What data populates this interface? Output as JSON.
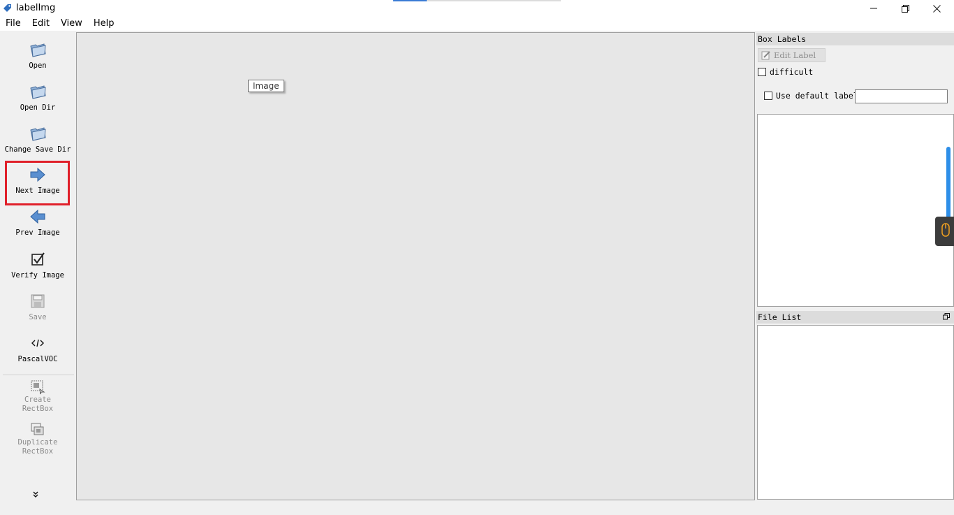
{
  "window": {
    "title": "labelImg",
    "minimize_icon": "minimize-icon",
    "maximize_icon": "restore-icon",
    "close_icon": "close-icon"
  },
  "menu": [
    "File",
    "Edit",
    "View",
    "Help"
  ],
  "toolbar": {
    "items": [
      {
        "label": "Open",
        "icon": "folder-icon",
        "enabled": true
      },
      {
        "label": "Open Dir",
        "icon": "folder-icon",
        "enabled": true
      },
      {
        "label": "Change Save Dir",
        "icon": "folder-icon",
        "enabled": true
      },
      {
        "label": "Next Image",
        "icon": "arrow-right-icon",
        "enabled": true,
        "highlighted": true
      },
      {
        "label": "Prev Image",
        "icon": "arrow-left-icon",
        "enabled": true
      },
      {
        "label": "Verify Image",
        "icon": "checkbox-icon",
        "enabled": true
      },
      {
        "label": "Save",
        "icon": "floppy-icon",
        "enabled": false
      },
      {
        "label": "PascalVOC",
        "icon": "code-icon",
        "enabled": true
      },
      {
        "label": "Create\nRectBox",
        "icon": "rectbox-icon",
        "enabled": false
      },
      {
        "label": "Duplicate\nRectBox",
        "icon": "duplicate-icon",
        "enabled": false
      }
    ],
    "highlight_color": "#e0202a",
    "expand_icon": "double-chevron-down-icon"
  },
  "canvas": {
    "tooltip": "Image"
  },
  "box_labels": {
    "title": "Box Labels",
    "edit_label_button": "Edit Label",
    "difficult_label": "difficult",
    "difficult_checked": false,
    "use_default_label": "Use default label",
    "use_default_checked": false,
    "default_label_value": ""
  },
  "file_list": {
    "title": "File List"
  },
  "colors": {
    "accent_scrollbar": "#2d8ee8",
    "canvas_bg": "#e7e7e7"
  }
}
